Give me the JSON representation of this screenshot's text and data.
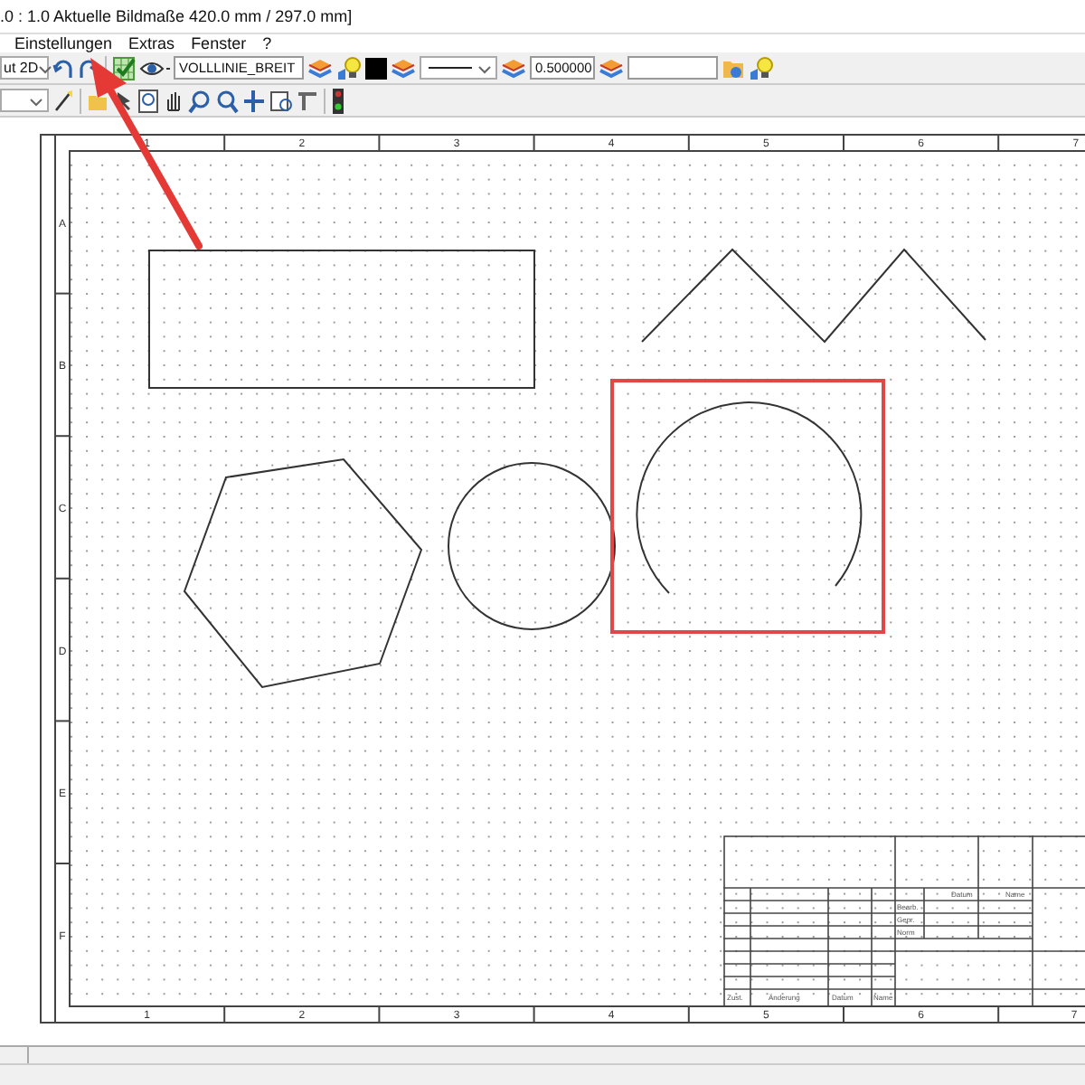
{
  "title_bar": {
    "text": ".0 : 1.0  Aktuelle Bildmaße 420.0 mm / 297.0 mm]"
  },
  "menu": [
    {
      "label": "Einstellungen"
    },
    {
      "label": "Extras"
    },
    {
      "label": "Fenster"
    },
    {
      "label": "?"
    }
  ],
  "toolbar": {
    "view_dropdown": "ut 2D",
    "line_type_field": "VOLLLINIE_BREIT",
    "line_width_field": "0.500000"
  },
  "drawing": {
    "top_column_labels": [
      "1",
      "2",
      "3",
      "4",
      "5",
      "6",
      "7"
    ],
    "bottom_column_labels": [
      "1",
      "2",
      "3",
      "4",
      "5",
      "6",
      "7"
    ],
    "row_labels": [
      "A",
      "B",
      "C",
      "D",
      "E",
      "F"
    ],
    "title_block": [
      {
        "text": "Datum"
      },
      {
        "text": "Name"
      },
      {
        "text": "Bearb."
      },
      {
        "text": "Gepr."
      },
      {
        "text": "Norm"
      },
      {
        "text": "Zust."
      },
      {
        "text": "Änderung"
      },
      {
        "text": "Datum"
      },
      {
        "text": "Name"
      }
    ]
  }
}
